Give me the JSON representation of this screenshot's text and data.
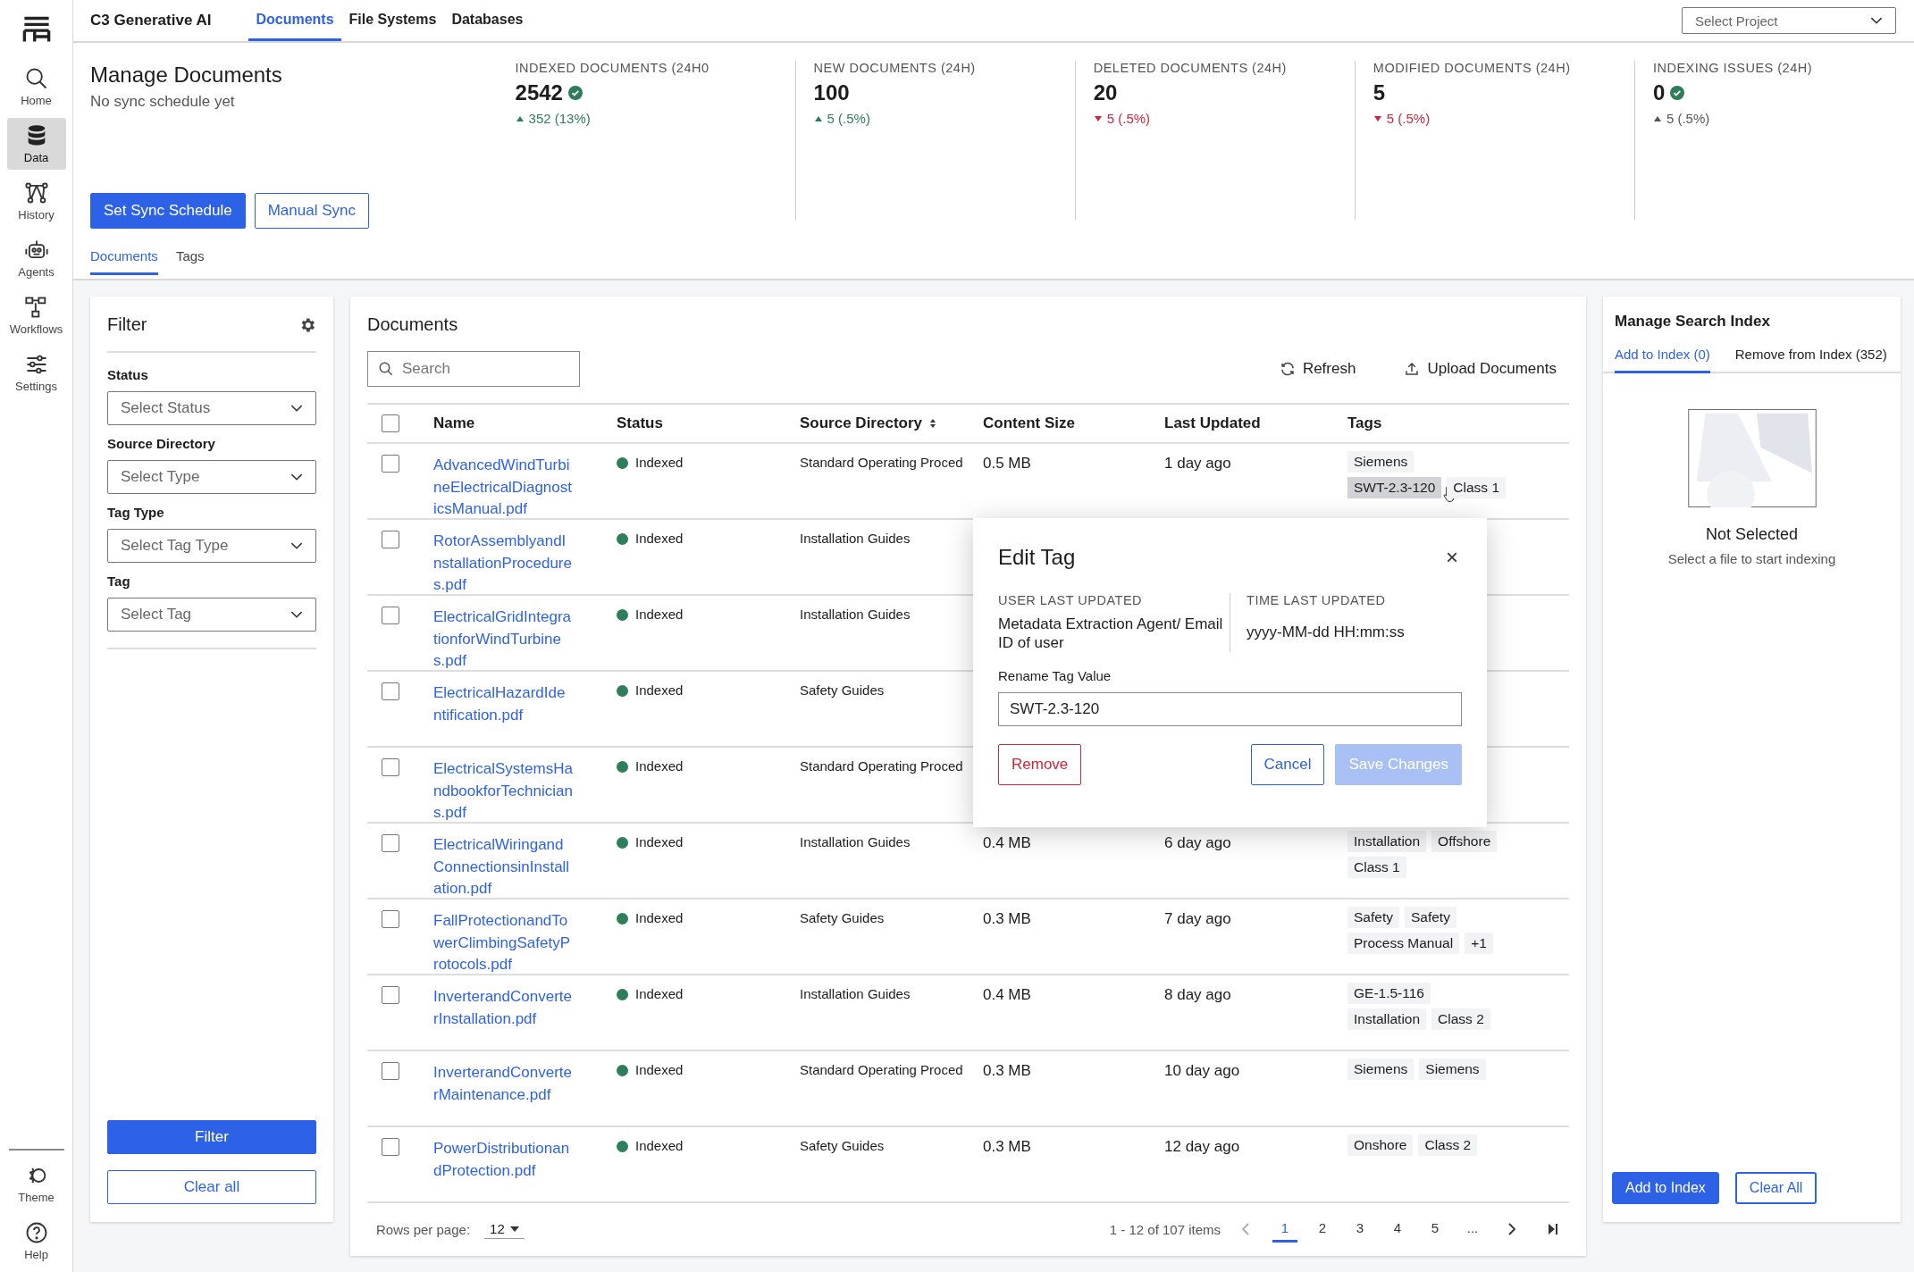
{
  "app": {
    "title": "C3 Generative AI"
  },
  "top_tabs": [
    {
      "label": "Documents",
      "selected": true
    },
    {
      "label": "File Systems",
      "selected": false
    },
    {
      "label": "Databases",
      "selected": false
    }
  ],
  "project_select": {
    "placeholder": "Select Project"
  },
  "nav": [
    {
      "label": "Home",
      "selected": false
    },
    {
      "label": "Data",
      "selected": true
    },
    {
      "label": "History",
      "selected": false
    },
    {
      "label": "Agents",
      "selected": false
    },
    {
      "label": "Workflows",
      "selected": false
    },
    {
      "label": "Settings",
      "selected": false
    }
  ],
  "nav_bottom": [
    {
      "label": "Theme"
    },
    {
      "label": "Help"
    }
  ],
  "header": {
    "title": "Manage Documents",
    "subtitle": "No sync schedule yet",
    "primary_button": "Set Sync Schedule",
    "secondary_button": "Manual Sync"
  },
  "stats": [
    {
      "label": "INDEXED DOCUMENTS (24H0",
      "value": "2542",
      "verified": true,
      "up": true,
      "kind": "positive",
      "delta": "352 (13%)"
    },
    {
      "label": "NEW DOCUMENTS (24H)",
      "value": "100",
      "up": true,
      "kind": "positive",
      "delta": "5 (.5%)"
    },
    {
      "label": "DELETED DOCUMENTS (24H)",
      "value": "20",
      "up": false,
      "kind": "negative",
      "delta": "5 (.5%)"
    },
    {
      "label": "MODIFIED DOCUMENTS (24H)",
      "value": "5",
      "up": false,
      "kind": "negative",
      "delta": "5 (.5%)"
    },
    {
      "label": "INDEXING ISSUES (24H)",
      "value": "0",
      "verified": true,
      "up": true,
      "kind": "neutral",
      "delta": "5 (.5%)"
    }
  ],
  "page_tabs": [
    {
      "label": "Documents",
      "selected": true
    },
    {
      "label": "Tags",
      "selected": false
    }
  ],
  "filter": {
    "title": "Filter",
    "fields": [
      {
        "label": "Status",
        "placeholder": "Select Status"
      },
      {
        "label": "Source Directory",
        "placeholder": "Select Type"
      },
      {
        "label": "Tag Type",
        "placeholder": "Select Tag Type"
      },
      {
        "label": "Tag",
        "placeholder": "Select Tag"
      }
    ],
    "apply_button": "Filter",
    "clear_button": "Clear all"
  },
  "documents": {
    "title": "Documents",
    "search_placeholder": "Search",
    "refresh": "Refresh",
    "upload": "Upload Documents",
    "all_checked": false,
    "columns": [
      {
        "label": "Name"
      },
      {
        "label": "Status"
      },
      {
        "label": "Source Directory",
        "sortable": true
      },
      {
        "label": "Content Size"
      },
      {
        "label": "Last Updated"
      },
      {
        "label": "Tags"
      }
    ],
    "rows": [
      {
        "checked": false,
        "name": "AdvancedWindTurbineElectricalDiagnosticsManual.pdf",
        "status": "Indexed",
        "source": "Standard Operating Proced",
        "size": "0.5 MB",
        "updated": "1 day ago",
        "tags": [
          [
            {
              "label": "Siemens",
              "selected": false
            }
          ],
          [
            {
              "label": "SWT-2.3-120",
              "selected": true
            },
            {
              "label": "Class 1",
              "selected": false
            }
          ]
        ]
      },
      {
        "checked": false,
        "name": "RotorAssemblyandInstallationProcedures.pdf",
        "status": "Indexed",
        "source": "Installation Guides"
      },
      {
        "checked": false,
        "name": "ElectricalGridIntegrationforWindTurbines.pdf",
        "status": "Indexed",
        "source": "Installation Guides"
      },
      {
        "checked": false,
        "name": "ElectricalHazardIdentification.pdf",
        "status": "Indexed",
        "source": "Safety Guides"
      },
      {
        "checked": false,
        "name": "ElectricalSystemsHandbookforTechnicians.pdf",
        "status": "Indexed",
        "source": "Standard Operating Proced"
      },
      {
        "checked": false,
        "name": "ElectricalWiringandConnectionsinInstallation.pdf",
        "status": "Indexed",
        "source": "Installation Guides",
        "size": "0.4 MB",
        "updated": "6 day ago",
        "tags": [
          [
            {
              "label": "Installation",
              "selected": false
            },
            {
              "label": "Offshore",
              "selected": false
            }
          ],
          [
            {
              "label": "Class 1",
              "selected": false
            }
          ]
        ]
      },
      {
        "checked": false,
        "name": "FallProtectionandTowerClimbingSafetyProtocols.pdf",
        "status": "Indexed",
        "source": "Safety Guides",
        "size": "0.3 MB",
        "updated": "7 day ago",
        "tags": [
          [
            {
              "label": "Safety",
              "selected": false
            },
            {
              "label": "Safety",
              "selected": false
            }
          ],
          [
            {
              "label": "Process Manual",
              "selected": false
            },
            {
              "label": "+1",
              "selected": false
            }
          ]
        ]
      },
      {
        "checked": false,
        "name": "InverterandConverterInstallation.pdf",
        "status": "Indexed",
        "source": "Installation Guides",
        "size": "0.4 MB",
        "updated": "8 day ago",
        "tags": [
          [
            {
              "label": "GE-1.5-116",
              "selected": false
            }
          ],
          [
            {
              "label": "Installation",
              "selected": false
            },
            {
              "label": "Class 2",
              "selected": false
            }
          ]
        ]
      },
      {
        "checked": false,
        "name": "InverterandConverterMaintenance.pdf",
        "status": "Indexed",
        "source": "Standard Operating Proced",
        "size": "0.3 MB",
        "updated": "10 day ago",
        "tags": [
          [
            {
              "label": "Siemens",
              "selected": false
            },
            {
              "label": "Siemens",
              "selected": false
            }
          ]
        ]
      },
      {
        "checked": false,
        "name": "PowerDistributionandProtection.pdf",
        "status": "Indexed",
        "source": "Safety Guides",
        "size": "0.3 MB",
        "updated": "12 day ago",
        "tags": [
          [
            {
              "label": "Onshore",
              "selected": false
            },
            {
              "label": "Class 2",
              "selected": false
            }
          ]
        ]
      }
    ],
    "rows_per_page_label": "Rows per page:",
    "rows_per_page": "12",
    "range": "1 - 12 of 107 items",
    "pages": [
      {
        "label": "1",
        "selected": true
      },
      {
        "label": "2",
        "selected": false
      },
      {
        "label": "3",
        "selected": false
      },
      {
        "label": "4",
        "selected": false
      },
      {
        "label": "5",
        "selected": false
      },
      {
        "label": "...",
        "selected": false
      }
    ]
  },
  "edit_tag": {
    "title": "Edit Tag",
    "close": "×",
    "user_label": "USER LAST UPDATED",
    "user_value": "Metadata Extraction Agent/ Email ID of user",
    "time_label": "TIME LAST UPDATED",
    "time_value": "yyyy-MM-dd HH:mm:ss",
    "rename_label": "Rename Tag Value",
    "rename_value": "SWT-2.3-120",
    "remove": "Remove",
    "cancel": "Cancel",
    "save": "Save Changes",
    "save_disabled": true
  },
  "search_index": {
    "title": "Manage Search Index",
    "tabs": [
      {
        "label": "Add to Index (0)",
        "selected": true
      },
      {
        "label": "Remove from Index (352)",
        "selected": false
      }
    ],
    "empty_title": "Not Selected",
    "empty_text": "Select a file to start indexing",
    "add_button": "Add to Index",
    "clear_button": "Clear All"
  }
}
